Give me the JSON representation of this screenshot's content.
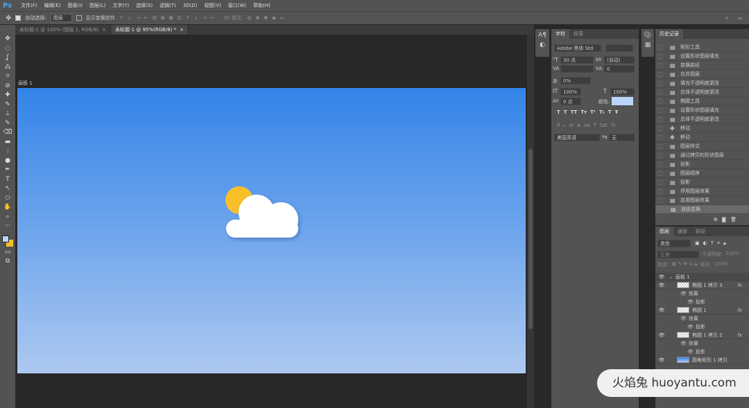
{
  "app": {
    "logo": "Ps"
  },
  "menu": [
    "文件(F)",
    "编辑(E)",
    "图像(I)",
    "图层(L)",
    "文字(Y)",
    "选择(S)",
    "滤镜(T)",
    "3D(D)",
    "视图(V)",
    "窗口(W)",
    "帮助(H)"
  ],
  "options": {
    "auto_select_label": "自动选择:",
    "auto_select_value": "图层",
    "show_transform_label": "显示变换控件",
    "mode_label": "3D 模式:"
  },
  "tabs": [
    {
      "label": "未标题-1 @ 100% (图层 1, RGB/8)",
      "close": "×"
    },
    {
      "label": "未标题-1 @ 95%(RGB/8) *",
      "close": "×"
    }
  ],
  "artboard_label": "画板 1",
  "colors": {
    "canvas_top": "#3484e8",
    "canvas_bottom": "#adc9f0",
    "sun": "#f7c02a",
    "text_color_swatch": "#b8d4f8"
  },
  "character": {
    "tabs": [
      "字符",
      "段落"
    ],
    "font_family": "Adobe 黑体 Std",
    "font_size": "30 点",
    "leading": "(自动)",
    "tracking": "0",
    "scale": "0%",
    "vertical_scale": "100%",
    "horizontal_scale": "100%",
    "baseline": "0 点",
    "color_label": "颜色:",
    "style_buttons": [
      "T",
      "T",
      "TT",
      "Tт",
      "T¹",
      "T₁",
      "T",
      "Ŧ"
    ],
    "opentype_buttons": [
      "fi",
      "ℴ",
      "st",
      "A",
      "aa",
      "T",
      "1st",
      "½"
    ],
    "language": "美国英语",
    "antialias": "无"
  },
  "history": {
    "title": "历史记录",
    "items": [
      {
        "icon": "doc",
        "label": "矩形工具"
      },
      {
        "icon": "doc",
        "label": "设置形状图层填充"
      },
      {
        "icon": "doc",
        "label": "变换路径"
      },
      {
        "icon": "doc",
        "label": "合并图层"
      },
      {
        "icon": "doc",
        "label": "填充不透明度更改"
      },
      {
        "icon": "doc",
        "label": "总体不透明度更改"
      },
      {
        "icon": "doc",
        "label": "椭圆工具"
      },
      {
        "icon": "doc",
        "label": "设置形状图层填充"
      },
      {
        "icon": "doc",
        "label": "总体不透明度更改"
      },
      {
        "icon": "move",
        "label": "移动"
      },
      {
        "icon": "move",
        "label": "移动"
      },
      {
        "icon": "doc",
        "label": "图层样式"
      },
      {
        "icon": "doc",
        "label": "通过拷贝的形状图层"
      },
      {
        "icon": "doc",
        "label": "投影"
      },
      {
        "icon": "doc",
        "label": "图层顺序"
      },
      {
        "icon": "doc",
        "label": "投影"
      },
      {
        "icon": "doc",
        "label": "停用图层效果"
      },
      {
        "icon": "doc",
        "label": "启用图层效果"
      },
      {
        "icon": "doc",
        "label": "自由变换"
      }
    ]
  },
  "layers": {
    "tabs": [
      "图层",
      "通道",
      "路径"
    ],
    "filter": "类型",
    "blend": "正常",
    "opacity_label": "不透明度:",
    "opacity": "100%",
    "lock_label": "锁定:",
    "fill_label": "填充:",
    "fill": "100%",
    "rows": [
      {
        "type": "group",
        "label": "画板 1"
      },
      {
        "type": "layer",
        "label": "椭圆 1 拷贝 3",
        "fx": "fx"
      },
      {
        "type": "effects",
        "label": "效果"
      },
      {
        "type": "effect",
        "label": "投影"
      },
      {
        "type": "layer",
        "label": "椭圆 1",
        "fx": "fx"
      },
      {
        "type": "effects",
        "label": "效果"
      },
      {
        "type": "effect",
        "label": "投影"
      },
      {
        "type": "layer",
        "label": "椭圆 1 拷贝 2",
        "fx": "fx"
      },
      {
        "type": "effects",
        "label": "效果"
      },
      {
        "type": "effect",
        "label": "投影"
      },
      {
        "type": "gradient",
        "label": "圆角矩形 1 拷贝"
      }
    ]
  },
  "watermark": "火焰兔 huoyantu.com"
}
